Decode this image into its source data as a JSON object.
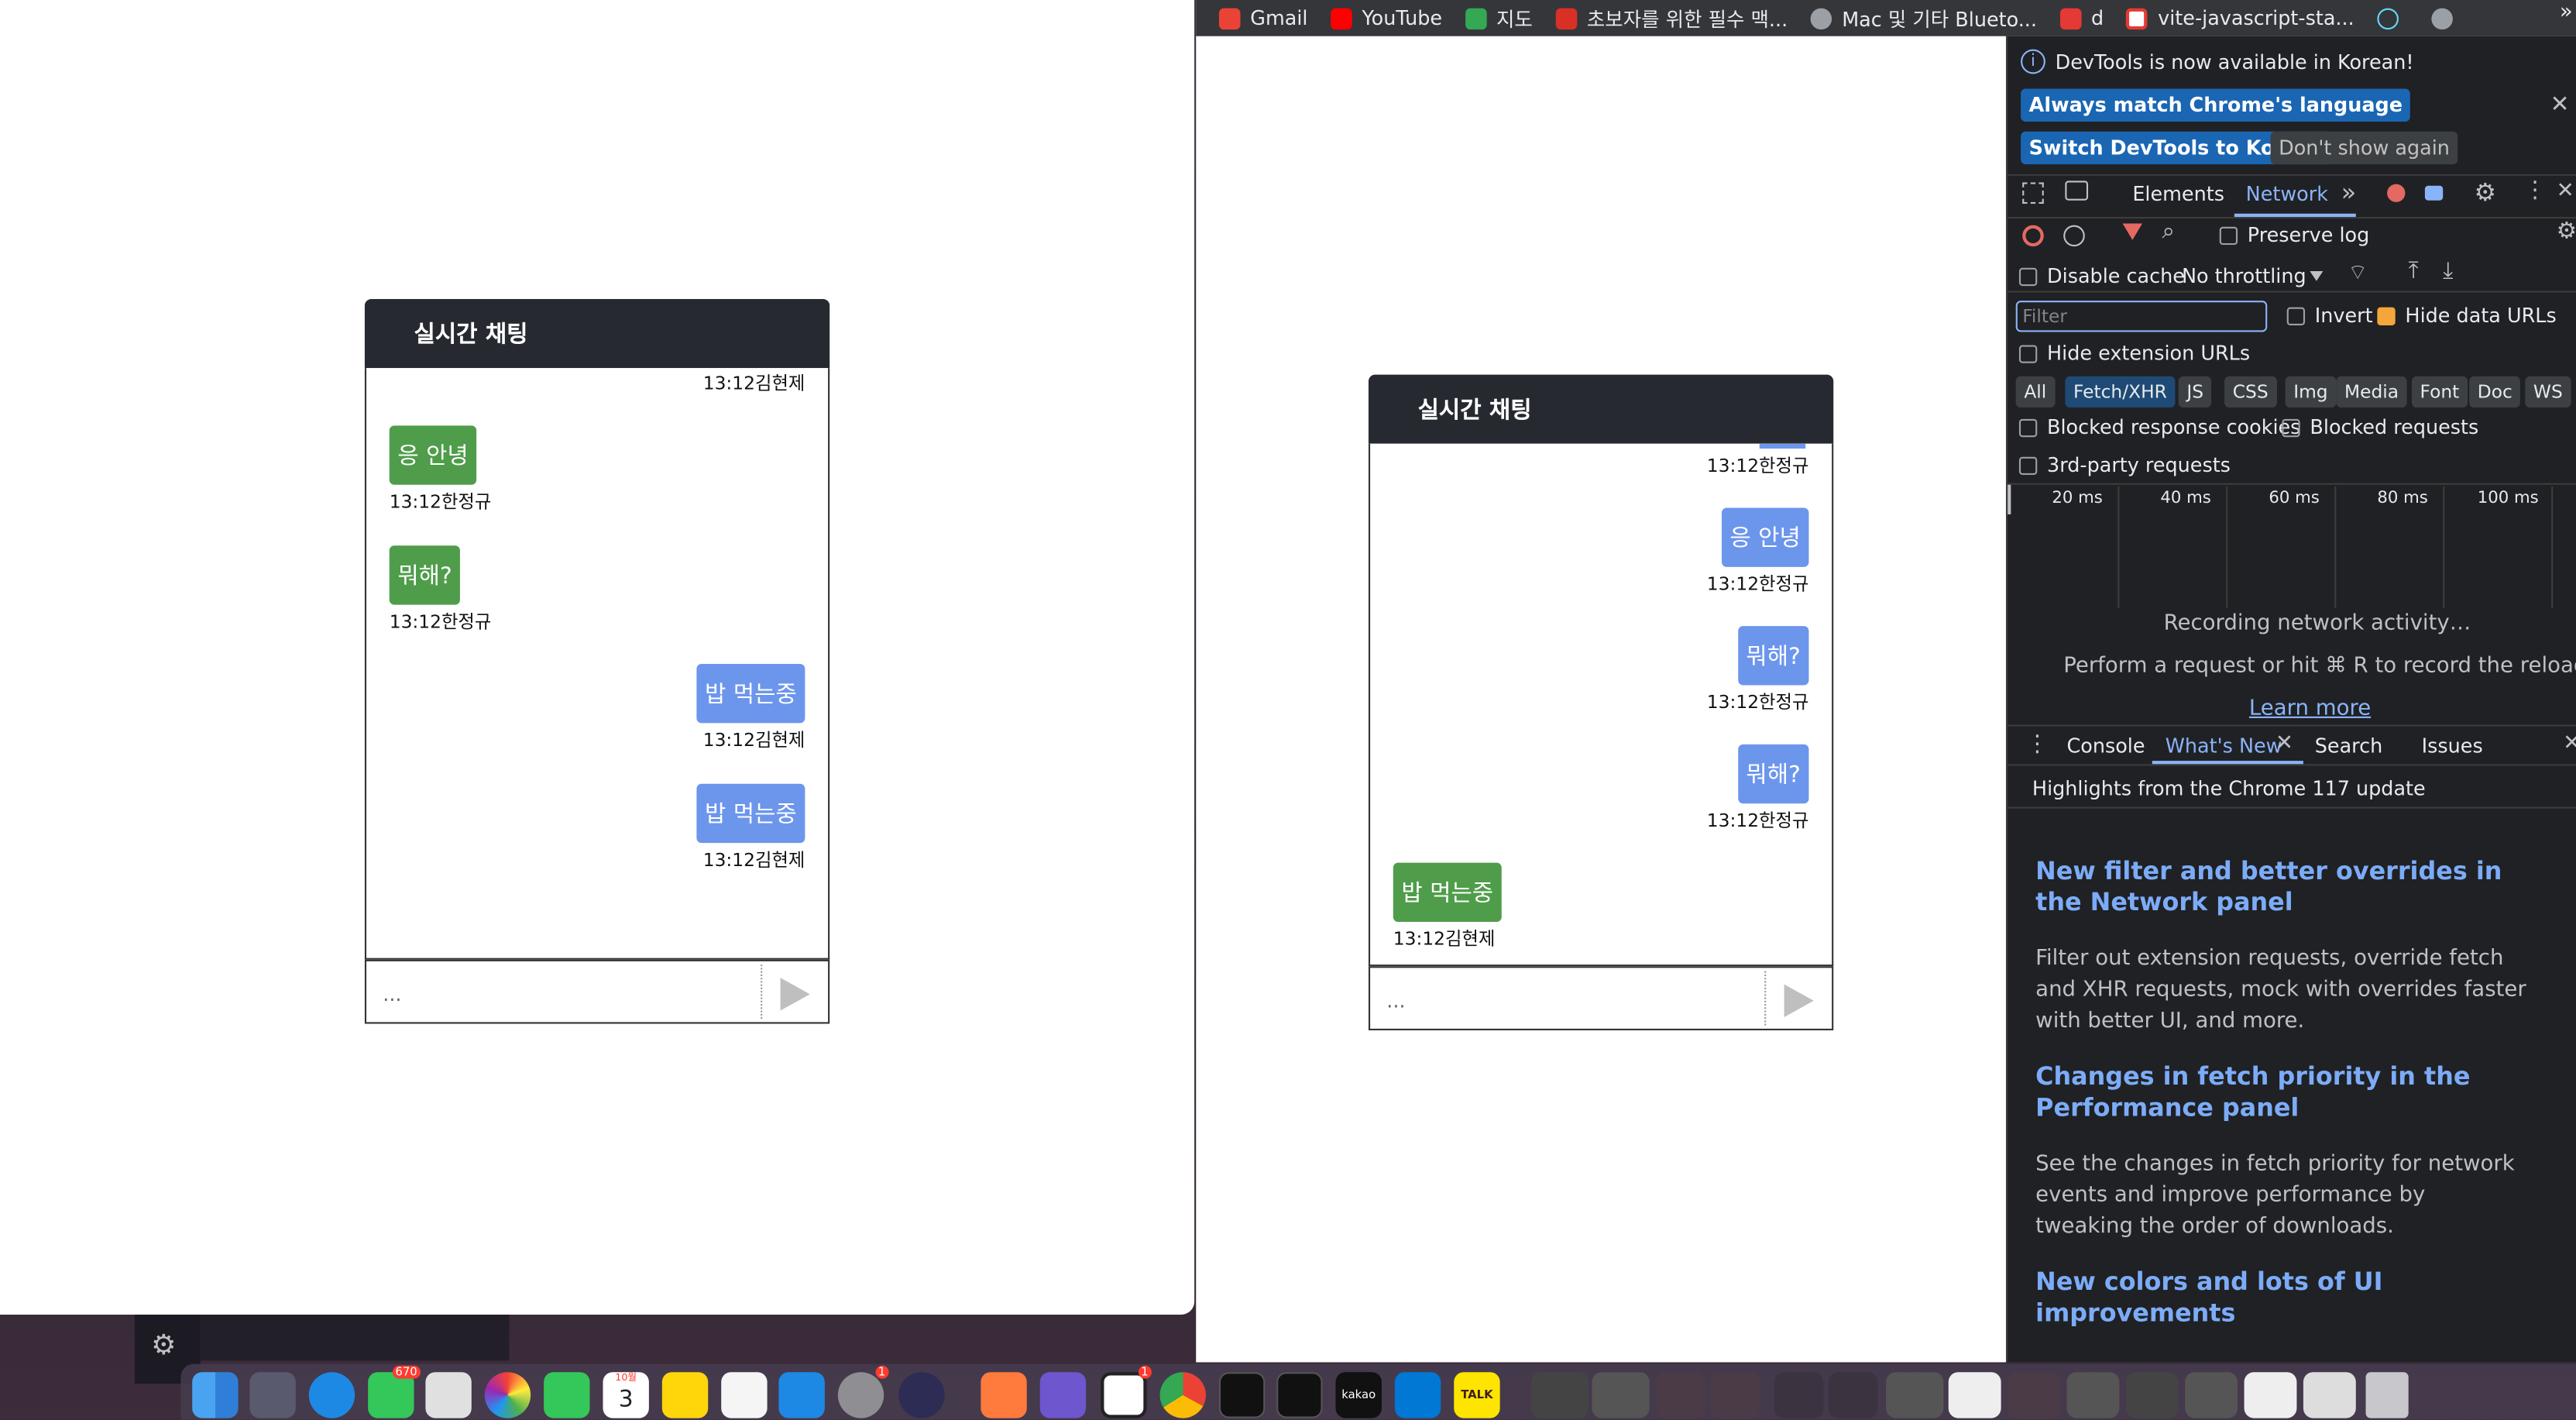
{
  "bookmarks": [
    {
      "label": "Gmail",
      "color": "#ea4335"
    },
    {
      "label": "YouTube",
      "color": "#ff0000"
    },
    {
      "label": "지도",
      "color": "#34a853"
    },
    {
      "label": "초보자를 위한 필수 맥...",
      "color": "#d93025"
    },
    {
      "label": "Mac 및 기타 Blueto...",
      "color": "#9aa0a6"
    },
    {
      "label": "d",
      "color": "#e53935"
    },
    {
      "label": "vite-javascript-sta...",
      "color": "#e53935"
    }
  ],
  "bookmarks_more": "»",
  "left_chat": {
    "title": "실시간 채팅",
    "top_meta": "13:12김현제",
    "messages": [
      {
        "text": "응 안녕",
        "meta": "13:12한정규",
        "side": "left",
        "color": "green"
      },
      {
        "text": "뭐해?",
        "meta": "13:12한정규",
        "side": "left",
        "color": "green"
      },
      {
        "text": "밥 먹는중",
        "meta": "13:12김현제",
        "side": "right",
        "color": "blue"
      },
      {
        "text": "밥 먹는중",
        "meta": "13:12김현제",
        "side": "right",
        "color": "blue"
      }
    ],
    "input_placeholder": "..."
  },
  "right_chat": {
    "title": "실시간 채팅",
    "top_meta": "13:12한정규",
    "messages": [
      {
        "text": "응 안녕",
        "meta": "13:12한정규",
        "side": "right",
        "color": "blue"
      },
      {
        "text": "뭐해?",
        "meta": "13:12한정규",
        "side": "right",
        "color": "blue"
      },
      {
        "text": "뭐해?",
        "meta": "13:12한정규",
        "side": "right",
        "color": "blue"
      },
      {
        "text": "밥 먹는중",
        "meta": "13:12김현제",
        "side": "left",
        "color": "green"
      }
    ],
    "input_placeholder": "..."
  },
  "devtools": {
    "banner": "DevTools is now available in Korean!",
    "btn_match": "Always match Chrome's language",
    "btn_switch": "Switch DevTools to Korean",
    "btn_dont": "Don't show again",
    "tabs": [
      "Elements",
      "Network"
    ],
    "active_tab": "Network",
    "preserve_log": "Preserve log",
    "disable_cache": "Disable cache",
    "throttling": "No throttling",
    "filter_placeholder": "Filter",
    "invert": "Invert",
    "hide_data_urls": "Hide data URLs",
    "hide_ext_urls": "Hide extension URLs",
    "type_filters": [
      "All",
      "Fetch/XHR",
      "JS",
      "CSS",
      "Img",
      "Media",
      "Font",
      "Doc",
      "WS"
    ],
    "selected_filter": "Fetch/XHR",
    "blocked_cookies": "Blocked response cookies",
    "blocked_requests": "Blocked requests",
    "third_party": "3rd-party requests",
    "timeline_ticks": [
      "20 ms",
      "40 ms",
      "60 ms",
      "80 ms",
      "100 ms"
    ],
    "recording": "Recording network activity…",
    "perform_hint": "Perform a request or hit ⌘ R to record the reload.",
    "learn_more": "Learn more",
    "drawer_tabs": [
      "Console",
      "What's New",
      "Search",
      "Issues"
    ],
    "active_drawer_tab": "What's New",
    "highlights": "Highlights from the Chrome 117 update",
    "whats_new": [
      {
        "title": "New filter and better overrides in the Network panel",
        "body": "Filter out extension requests, override fetch and XHR requests, mock with overrides faster with better UI, and more."
      },
      {
        "title": "Changes in fetch priority in the Performance panel",
        "body": "See the changes in fetch priority for network events and improve performance by tweaking the order of downloads."
      },
      {
        "title": "New colors and lots of UI improvements",
        "body": ""
      }
    ]
  },
  "dock": {
    "messages_badge": "670",
    "settings_badge": "1",
    "calendar_month": "10월",
    "calendar_day": "3",
    "notion_badge": "1",
    "kakao_label": "kakao",
    "talk_label": "TALK"
  }
}
